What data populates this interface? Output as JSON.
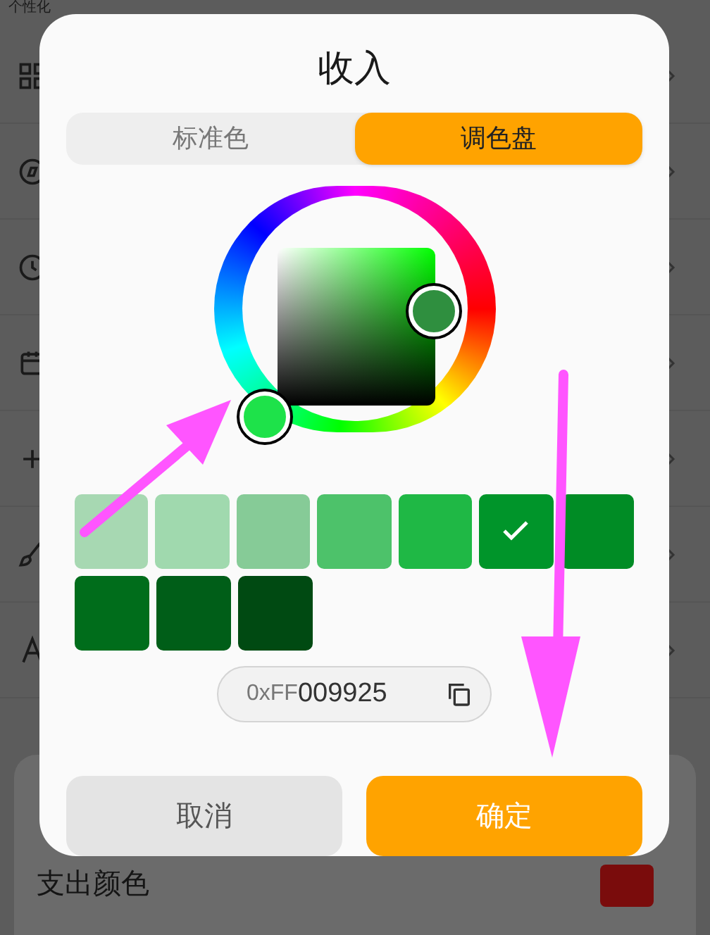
{
  "background": {
    "header": "个性化",
    "rows": [
      {
        "kind": "grid"
      },
      {
        "kind": "compass"
      },
      {
        "kind": "clock"
      },
      {
        "kind": "calendar"
      },
      {
        "kind": "plus"
      },
      {
        "kind": "brush"
      },
      {
        "kind": "letter"
      }
    ],
    "sheet_row": {
      "label": "支出颜色",
      "color": "#7a0c0c"
    }
  },
  "dialog": {
    "title": "收入",
    "tabs": [
      {
        "label": "标准色",
        "selected": false
      },
      {
        "label": "调色盘",
        "selected": true
      }
    ],
    "swatches": [
      {
        "color": "#a7d8b2",
        "selected": false
      },
      {
        "color": "#a0d9ae",
        "selected": false
      },
      {
        "color": "#86cb97",
        "selected": false
      },
      {
        "color": "#4dc26a",
        "selected": false
      },
      {
        "color": "#1fb845",
        "selected": false
      },
      {
        "color": "#00952a",
        "selected": true
      },
      {
        "color": "#008c25",
        "selected": false
      },
      {
        "color": "#006d1b",
        "selected": false
      },
      {
        "color": "#005e18",
        "selected": false
      },
      {
        "color": "#004a12",
        "selected": false
      }
    ],
    "hex_prefix": "0xFF",
    "hex_value": "009925",
    "buttons": [
      {
        "label": "取消",
        "kind": "cancel"
      },
      {
        "label": "确定",
        "kind": "confirm"
      }
    ]
  }
}
